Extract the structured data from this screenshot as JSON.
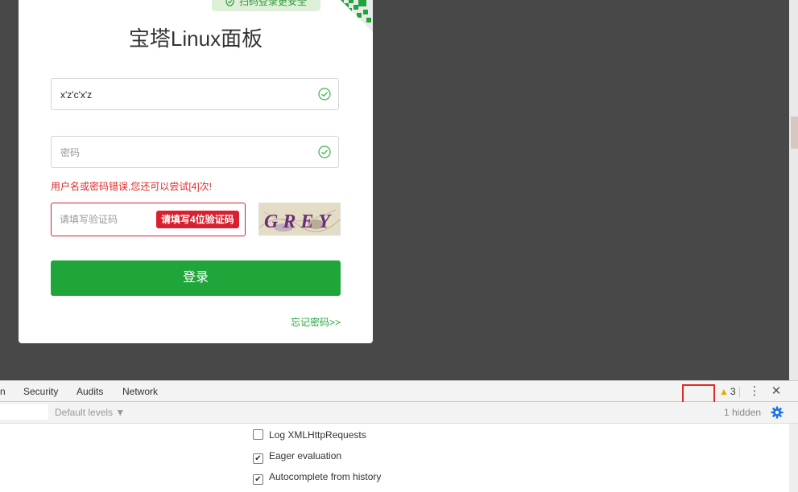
{
  "login": {
    "qr_tip": "扫码登录更安全",
    "title": "宝塔Linux面板",
    "username_value": "x'z'c'x'z",
    "password_placeholder": "密码",
    "error_message": "用户名或密码错误,您还可以尝试[4]次!",
    "captcha_placeholder": "请填写验证码",
    "captcha_tip": "请填写4位验证码",
    "captcha_text": "GREY",
    "login_button": "登录",
    "forgot_link": "忘记密码>>"
  },
  "devtools": {
    "tabs": [
      "n",
      "Security",
      "Audits",
      "Network"
    ],
    "warning_count": "3",
    "levels_label": "Default levels ▼",
    "hidden_label": "1 hidden",
    "settings": [
      {
        "label": "Log XMLHttpRequests",
        "checked": false
      },
      {
        "label": "Eager evaluation",
        "checked": true
      },
      {
        "label": "Autocomplete from history",
        "checked": true
      }
    ]
  },
  "colors": {
    "brand_green": "#20a53a",
    "error_red": "#e02828",
    "backdrop": "#484848"
  },
  "icons": [
    "shield-icon",
    "qr-code-icon",
    "check-circle-icon",
    "warning-icon",
    "kebab-menu-icon",
    "close-icon",
    "gear-icon"
  ]
}
